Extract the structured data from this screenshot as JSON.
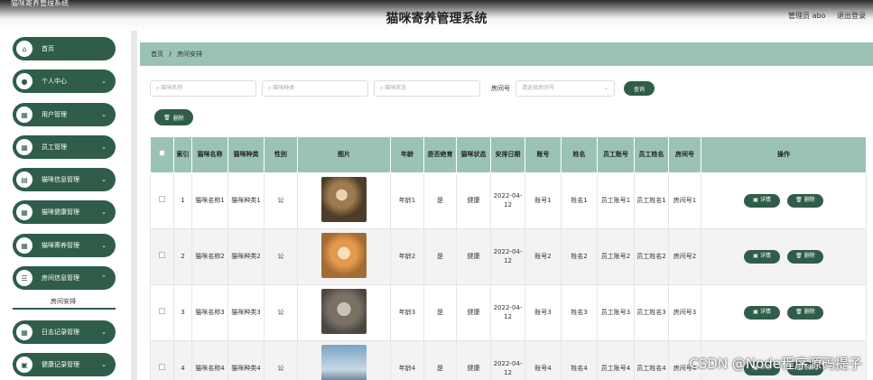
{
  "window_title": "猫咪寄养管理系统",
  "app_title": "猫咪寄养管理系统",
  "header": {
    "user": "管理员 abo",
    "logout": "退出登录"
  },
  "sidebar": {
    "items": [
      {
        "label": "首页",
        "icon": "home-icon",
        "glyph": "⌂",
        "chevron": ""
      },
      {
        "label": "个人中心",
        "icon": "user-icon",
        "glyph": "●",
        "chevron": "⌄"
      },
      {
        "label": "用户管理",
        "icon": "grid-icon",
        "glyph": "▦",
        "chevron": "⌄"
      },
      {
        "label": "员工管理",
        "icon": "grid-icon",
        "glyph": "▦",
        "chevron": "⌄"
      },
      {
        "label": "猫咪信息管理",
        "icon": "id-card-icon",
        "glyph": "▤",
        "chevron": "⌄"
      },
      {
        "label": "猫咪健康管理",
        "icon": "grid-icon",
        "glyph": "▦",
        "chevron": "⌄"
      },
      {
        "label": "猫咪寄养管理",
        "icon": "grid-icon",
        "glyph": "▦",
        "chevron": "⌄"
      },
      {
        "label": "房间信息管理",
        "icon": "list-icon",
        "glyph": "☰",
        "chevron": "⌃"
      },
      {
        "label": "日志记录管理",
        "icon": "grid-icon",
        "glyph": "▦",
        "chevron": "⌄"
      },
      {
        "label": "健康记录管理",
        "icon": "bag-icon",
        "glyph": "▣",
        "chevron": "⌄"
      }
    ],
    "submenu": "房间安排"
  },
  "breadcrumb": {
    "home": "首页",
    "sep": "/",
    "current": "房间安排"
  },
  "search": {
    "name_placeholder": "猫咪名称",
    "type_placeholder": "猫咪种类",
    "status_placeholder": "猫咪状态",
    "room_label": "房间号",
    "room_placeholder": "请选择房间号",
    "search_button": "查询"
  },
  "delete_button": "删除",
  "table": {
    "headers": [
      "索引",
      "猫咪名称",
      "猫咪种类",
      "性别",
      "图片",
      "年龄",
      "是否绝育",
      "猫咪状态",
      "安排日期",
      "账号",
      "姓名",
      "员工账号",
      "员工姓名",
      "房间号",
      "操作"
    ],
    "rows": [
      {
        "idx": "1",
        "name": "猫咪名称1",
        "type": "猫咪种类1",
        "sex": "公",
        "age": "年龄1",
        "neutered": "是",
        "status": "健康",
        "date": "2022-04-12",
        "account": "账号1",
        "uname": "姓名1",
        "staff_account": "员工账号1",
        "staff_name": "员工姓名1",
        "room": "房间号1"
      },
      {
        "idx": "2",
        "name": "猫咪名称2",
        "type": "猫咪种类2",
        "sex": "公",
        "age": "年龄2",
        "neutered": "是",
        "status": "健康",
        "date": "2022-04-12",
        "account": "账号2",
        "uname": "姓名2",
        "staff_account": "员工账号2",
        "staff_name": "员工姓名2",
        "room": "房间号2"
      },
      {
        "idx": "3",
        "name": "猫咪名称3",
        "type": "猫咪种类3",
        "sex": "公",
        "age": "年龄3",
        "neutered": "是",
        "status": "健康",
        "date": "2022-04-12",
        "account": "账号3",
        "uname": "姓名3",
        "staff_account": "员工账号3",
        "staff_name": "员工姓名3",
        "room": "房间号3"
      },
      {
        "idx": "4",
        "name": "猫咪名称4",
        "type": "猫咪种类4",
        "sex": "公",
        "age": "年龄4",
        "neutered": "是",
        "status": "健康",
        "date": "2022-04-12",
        "account": "账号4",
        "uname": "姓名4",
        "staff_account": "员工账号4",
        "staff_name": "员工姓名4",
        "room": "房间号4"
      }
    ],
    "detail_button": "详情",
    "delete_button": "删除"
  },
  "watermark": "CSDN @Node程序源码提子",
  "colors": {
    "primary": "#2f5d4a",
    "header_bg": "#9bc3b4"
  }
}
